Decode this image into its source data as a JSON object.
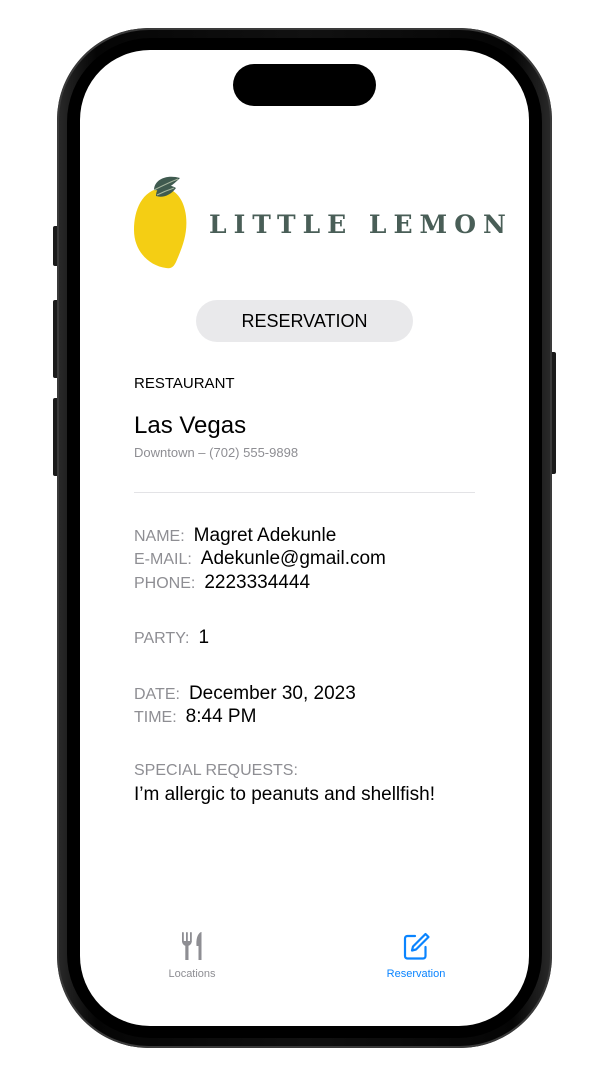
{
  "app": {
    "brand_name": "LITTLE LEMON"
  },
  "header": {
    "reservation_button_label": "RESERVATION"
  },
  "restaurant": {
    "section_label": "RESTAURANT",
    "city": "Las Vegas",
    "neighborhood_line": "Downtown  –  (702) 555-9898"
  },
  "customer": {
    "name_label": "NAME:",
    "name_value": "Magret Adekunle",
    "email_label": "E-MAIL:",
    "email_value": "Adekunle@gmail.com",
    "phone_label": "PHONE:",
    "phone_value": "2223334444"
  },
  "party": {
    "label": "PARTY:",
    "value": "1"
  },
  "schedule": {
    "date_label": "DATE:",
    "date_value": "December 30, 2023",
    "time_label": "TIME:",
    "time_value": "8:44 PM"
  },
  "special_requests": {
    "label": "SPECIAL REQUESTS:",
    "value": "I’m allergic to peanuts and shellfish!"
  },
  "tab_bar": {
    "tabs": [
      {
        "label": "Locations",
        "icon": "fork-knife-icon",
        "selected": false
      },
      {
        "label": "Reservation",
        "icon": "square-pencil-icon",
        "selected": true
      }
    ]
  },
  "colors": {
    "brand_green": "#495e57",
    "lemon_yellow": "#f4ce14",
    "accent_blue": "#0a84ff",
    "secondary_gray": "#8e8e93",
    "pill_background": "#e9e9eb"
  }
}
